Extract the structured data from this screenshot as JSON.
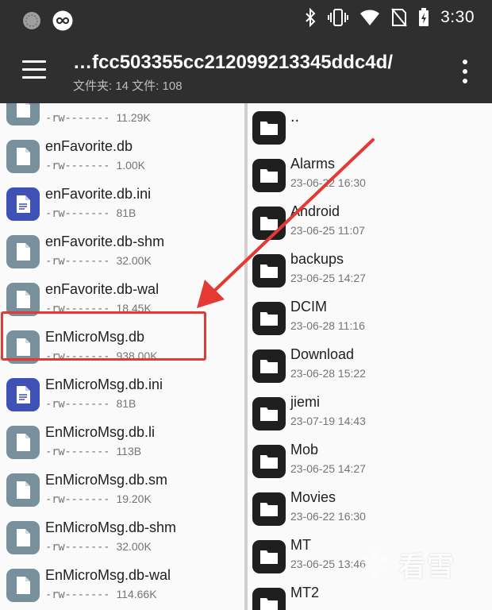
{
  "status_bar": {
    "time": "3:30",
    "icons": [
      "app-circle-icon",
      "infinity-app-icon",
      "bluetooth-icon",
      "vibrate-icon",
      "wifi-icon",
      "no-sim-icon",
      "battery-charging-icon"
    ]
  },
  "app_bar": {
    "title": "…fcc503355cc212099213345ddc4d/",
    "subtitle": "文件夹: 14  文件: 108"
  },
  "left_panel": {
    "files": [
      {
        "name": "",
        "meta": "-rw-------",
        "size": "11.29K",
        "icon": "file-icon"
      },
      {
        "name": "enFavorite.db",
        "meta": "-rw-------",
        "size": "1.00K",
        "icon": "file-icon"
      },
      {
        "name": "enFavorite.db.ini",
        "meta": "-rw-------",
        "size": "81B",
        "icon": "text-file-icon"
      },
      {
        "name": "enFavorite.db-shm",
        "meta": "-rw-------",
        "size": "32.00K",
        "icon": "file-icon"
      },
      {
        "name": "enFavorite.db-wal",
        "meta": "-rw-------",
        "size": "18.45K",
        "icon": "file-icon"
      },
      {
        "name": "EnMicroMsg.db",
        "meta": "-rw-------",
        "size": "938.00K",
        "icon": "file-icon"
      },
      {
        "name": "EnMicroMsg.db.ini",
        "meta": "-rw-------",
        "size": "81B",
        "icon": "text-file-icon"
      },
      {
        "name": "EnMicroMsg.db.li",
        "meta": "-rw-------",
        "size": "113B",
        "icon": "file-icon"
      },
      {
        "name": "EnMicroMsg.db.sm",
        "meta": "-rw-------",
        "size": "19.20K",
        "icon": "file-icon"
      },
      {
        "name": "EnMicroMsg.db-shm",
        "meta": "-rw-------",
        "size": "32.00K",
        "icon": "file-icon"
      },
      {
        "name": "EnMicroMsg.db-wal",
        "meta": "-rw-------",
        "size": "114.66K",
        "icon": "file-icon"
      }
    ]
  },
  "right_panel": {
    "parent": "..",
    "folders": [
      {
        "name": "Alarms",
        "date": "23-06-22 16:30"
      },
      {
        "name": "Android",
        "date": "23-06-25 11:07"
      },
      {
        "name": "backups",
        "date": "23-06-25 14:27"
      },
      {
        "name": "DCIM",
        "date": "23-06-28 11:16"
      },
      {
        "name": "Download",
        "date": "23-06-28 15:22"
      },
      {
        "name": "jiemi",
        "date": "23-07-19 14:43"
      },
      {
        "name": "Mob",
        "date": "23-06-25 14:27"
      },
      {
        "name": "Movies",
        "date": "23-06-22 16:30"
      },
      {
        "name": "MT",
        "date": "23-06-25 13:46"
      },
      {
        "name": "MT2",
        "date": ""
      }
    ]
  },
  "watermark": {
    "text": "看雪"
  },
  "colors": {
    "appbar": "#2f2f2f",
    "annotation": "#e53935",
    "file_icon": "#78909c",
    "text_file_icon": "#3f51b5"
  }
}
